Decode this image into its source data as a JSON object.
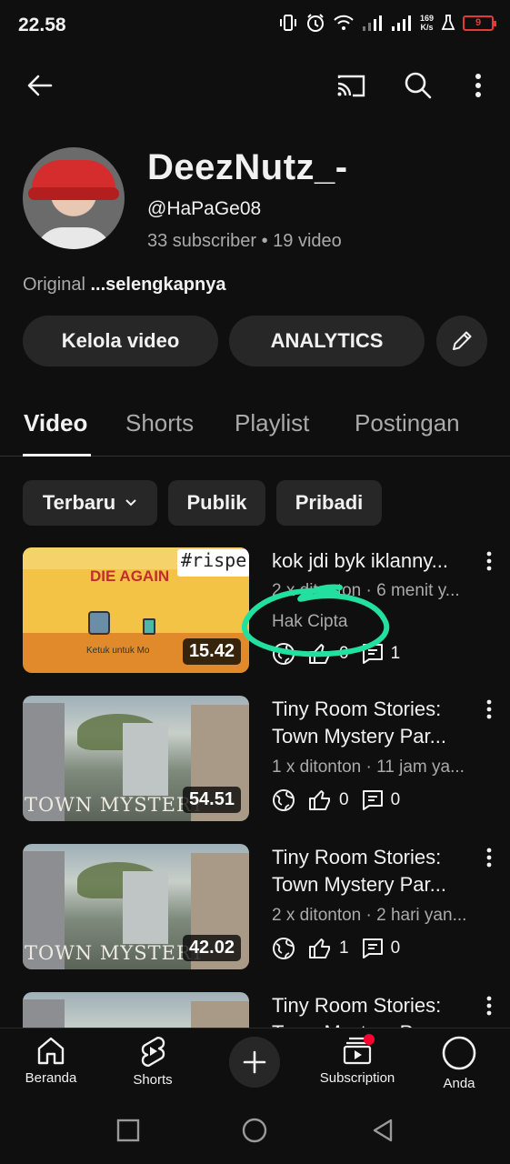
{
  "status_bar": {
    "time": "22.58",
    "net_speed_value": "169",
    "net_speed_unit": "K/s",
    "battery": "9"
  },
  "top_bar": {
    "icons": [
      "back-arrow-icon",
      "cast-icon",
      "search-icon",
      "more-vert-icon"
    ]
  },
  "channel": {
    "name": "DeezNutz_-",
    "handle": "@HaPaGe08",
    "stats": "33 subscriber • 19 video",
    "description_prefix": "Original",
    "description_more": "...selengkapnya"
  },
  "actions": {
    "manage_videos": "Kelola video",
    "analytics": "ANALYTICS",
    "edit_icon": "pencil-icon"
  },
  "tabs": [
    "Video",
    "Shorts",
    "Playlist",
    "Postingan"
  ],
  "active_tab": "Video",
  "filters": {
    "sort": "Terbaru",
    "public": "Publik",
    "private": "Pribadi"
  },
  "videos": [
    {
      "title_line1": "kok jdi byk iklanny...",
      "meta": "2 x ditonton · 6 menit y...",
      "extra": "Hak Cipta",
      "duration": "15.42",
      "likes": "0",
      "comments": "1",
      "thumb_title": "DIE AGAIN",
      "thumb_tag": "#rispe",
      "thumb_hint": "Ketuk untuk Mo"
    },
    {
      "title_line1": "Tiny Room Stories:",
      "title_line2": "Town Mystery Par...",
      "meta": "1 x ditonton · 11 jam ya...",
      "duration": "54.51",
      "likes": "0",
      "comments": "0",
      "thumb_text": "TOWN MYSTERY"
    },
    {
      "title_line1": "Tiny Room Stories:",
      "title_line2": "Town Mystery Par...",
      "meta": "2 x ditonton · 2 hari yan...",
      "duration": "42.02",
      "likes": "1",
      "comments": "0",
      "thumb_text": "TOWN MYSTERY"
    },
    {
      "title_line1": "Tiny Room Stories:",
      "title_line2": "Town Mystery Par..."
    }
  ],
  "bottom_nav": {
    "home": "Beranda",
    "shorts": "Shorts",
    "subscription": "Subscription",
    "you": "Anda"
  },
  "colors": {
    "background": "#0f0f0f",
    "chip": "#272727",
    "secondary_text": "#aaaaaa",
    "annotation": "#22e0a0",
    "notification": "#ff0033",
    "battery_low": "#e53935"
  }
}
